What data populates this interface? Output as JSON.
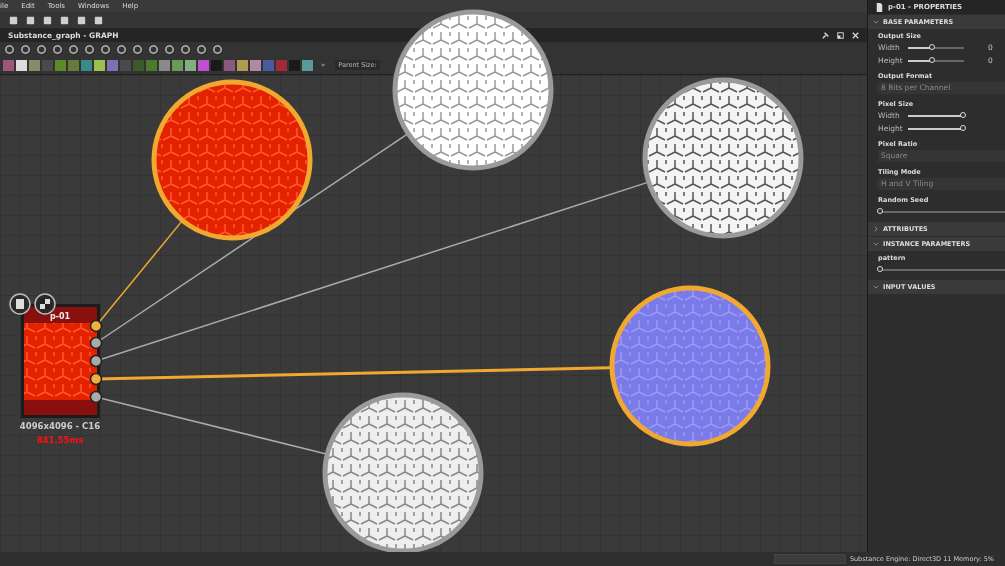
{
  "menu": [
    "ile",
    "Edit",
    "Tools",
    "Windows",
    "Help"
  ],
  "graph": {
    "title": "Substance_graph - GRAPH",
    "parent_size": "Parent Size:",
    "more": "»",
    "nodes_toolbar": [
      {
        "color": "#a0557a"
      },
      {
        "color": "#dddddd"
      },
      {
        "color": "#8a8a6a"
      },
      {
        "color": "#4a4a4a"
      },
      {
        "color": "#5a8a2a"
      },
      {
        "color": "#6a7a3a"
      },
      {
        "color": "#3a8a8a"
      },
      {
        "color": "#9ac050"
      },
      {
        "color": "#8070b0"
      },
      {
        "color": "#4a4a4a"
      },
      {
        "color": "#3a5a2a"
      },
      {
        "color": "#4a7a2a"
      },
      {
        "color": "#8a8a8a"
      },
      {
        "color": "#6a9a5a"
      },
      {
        "color": "#80b080"
      },
      {
        "color": "#c050d0"
      },
      {
        "color": "#1a1a1a"
      },
      {
        "color": "#8a5a7a"
      },
      {
        "color": "#b09a50"
      },
      {
        "color": "#b08aa0"
      },
      {
        "color": "#4a5aa0"
      },
      {
        "color": "#a02a3a"
      },
      {
        "color": "#1a1a1a"
      },
      {
        "color": "#5a9a9a"
      }
    ],
    "node": {
      "label": "p-01",
      "size": "4096x4096 - C16",
      "time": "841.55ms"
    },
    "outputs": [
      {
        "selected": true,
        "kind": "base"
      },
      {
        "selected": false,
        "kind": "white"
      },
      {
        "selected": false,
        "kind": "dense"
      },
      {
        "selected": true,
        "kind": "normal"
      },
      {
        "selected": false,
        "kind": "light"
      }
    ]
  },
  "properties": {
    "title": "p-01 - PROPERTIES",
    "sections": [
      {
        "title": "BASE PARAMETERS",
        "expanded": true,
        "params": [
          {
            "kind": "pair",
            "label": "Output Size",
            "rows": [
              {
                "label": "Width",
                "level": 0.45,
                "value": "0"
              },
              {
                "label": "Height",
                "level": 0.45,
                "value": "0"
              }
            ]
          },
          {
            "kind": "dropdown",
            "label": "Output Format",
            "value": "8 Bits per Channel"
          },
          {
            "kind": "pair",
            "label": "Pixel Size",
            "rows": [
              {
                "label": "Width",
                "level": 1
              },
              {
                "label": "Height",
                "level": 1
              }
            ]
          },
          {
            "kind": "dropdown",
            "label": "Pixel Ratio",
            "value": "Square"
          },
          {
            "kind": "dropdown",
            "label": "Tiling Mode",
            "value": "H and V Tiling"
          },
          {
            "kind": "slider",
            "label": "Random Seed",
            "level": 0
          }
        ]
      },
      {
        "title": "ATTRIBUTES",
        "expanded": false
      },
      {
        "title": "INSTANCE PARAMETERS",
        "expanded": true,
        "params": [
          {
            "kind": "slider",
            "label": "pattern",
            "level": 0
          }
        ]
      },
      {
        "title": "INPUT VALUES",
        "expanded": true
      }
    ]
  },
  "status": "Substance Engine: Direct3D 11  Memory: 5%"
}
